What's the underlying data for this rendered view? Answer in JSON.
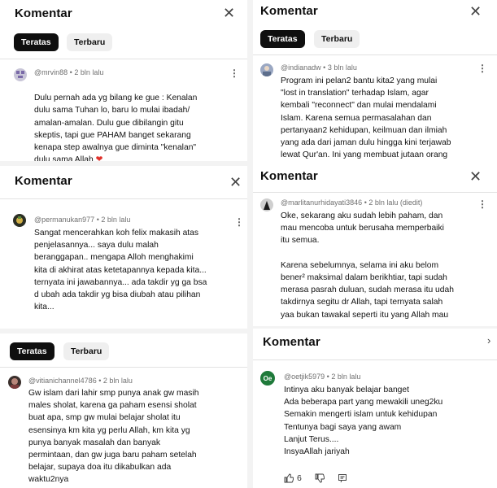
{
  "panels": {
    "p1": {
      "title": "Komentar",
      "tabs": [
        "Teratas",
        "Terbaru"
      ],
      "comment": {
        "author": "@mrvin88",
        "time": "2 bln lalu",
        "text": "Dulu pernah ada yg bilang ke gue : Kenalan\ndulu sama Tuhan lo, baru lo mulai ibadah/\namalan-amalan. Dulu gue dibilangin gitu\nskeptis, tapi gue PAHAM banget sekarang\nkenapa step awalnya gue diminta \"kenalan\"\ndulu sama Allah"
      }
    },
    "p2": {
      "title": "Komentar",
      "tabs": [
        "Teratas",
        "Terbaru"
      ],
      "comment": {
        "author": "@indianadw",
        "time": "3 bln lalu",
        "text": "Program ini pelan2 bantu kita2 yang mulai\n\"lost in translation\" terhadap Islam, agar\nkembali \"reconnect\" dan mulai mendalami\nIslam.  Karena semua permasalahan dan\npertanyaan2  kehidupan, keilmuan dan ilmiah\nyang ada dari jaman dulu hingga kini terjawab\nlewat Qur'an. Ini yang membuat jutaan orang"
      }
    },
    "p3": {
      "title": "Komentar",
      "comment": {
        "author": "@permanukan977",
        "time": "2 bln lalu",
        "text": "Sangat mencerahkan koh felix makasih atas\npenjelasannya... saya dulu malah\nberanggapan.. mengapa Alloh menghakimi\nkita di akhirat atas ketetapannya kepada kita...\nternyata ini jawabannya... ada takdir yg ga bsa\nd ubah ada takdir yg bisa diubah atau pilihan\nkita..."
      }
    },
    "p4": {
      "title": "Komentar",
      "comment": {
        "author": "@marlitanurhidayati3846",
        "time": "2 bln lalu (diedit)",
        "text": "Oke, sekarang aku sudah lebih paham, dan\nmau mencoba untuk berusaha memperbaiki\nitu semua.\n\nKarena sebelumnya, selama ini aku belom\nbener² maksimal dalam berikhtiar, tapi sudah\nmerasa pasrah duluan, sudah merasa itu udah\ntakdirnya segitu dr Allah, tapi ternyata salah\nyaa bukan tawakal seperti itu yang Allah mau"
      }
    },
    "p5": {
      "tabs": [
        "Teratas",
        "Terbaru"
      ],
      "comment": {
        "author": "@vitianichannel4786",
        "time": "2 bln lalu",
        "text": "Gw islam dari lahir smp punya anak  gw masih\nmales sholat, karena ga paham esensi sholat\nbuat apa, smp gw mulai belajar sholat itu\nesensinya km kita yg perlu Allah, km kita yg\npunya banyak masalah dan banyak\npermintaan, dan gw juga baru paham setelah\nbelajar, supaya doa itu dikabulkan ada\nwaktu2nya"
      }
    },
    "p6": {
      "title": "Komentar",
      "comment": {
        "author": "@oetjik5979",
        "time": "2 bln lalu",
        "avatar_text": "Oe",
        "text": "Intinya aku banyak belajar banget\nAda beberapa part yang mewakili uneg2ku\nSemakin mengerti islam untuk kehidupan\nTentunya bagi saya yang awam\nLanjut Terus....\nInsyaAllah jariyah",
        "likes": "6"
      }
    }
  },
  "colors": {
    "heart": "#e0302a",
    "avatar_green": "#1f7a3a",
    "chip_active": "#0f0f0f",
    "chip_inactive": "#efefef"
  }
}
